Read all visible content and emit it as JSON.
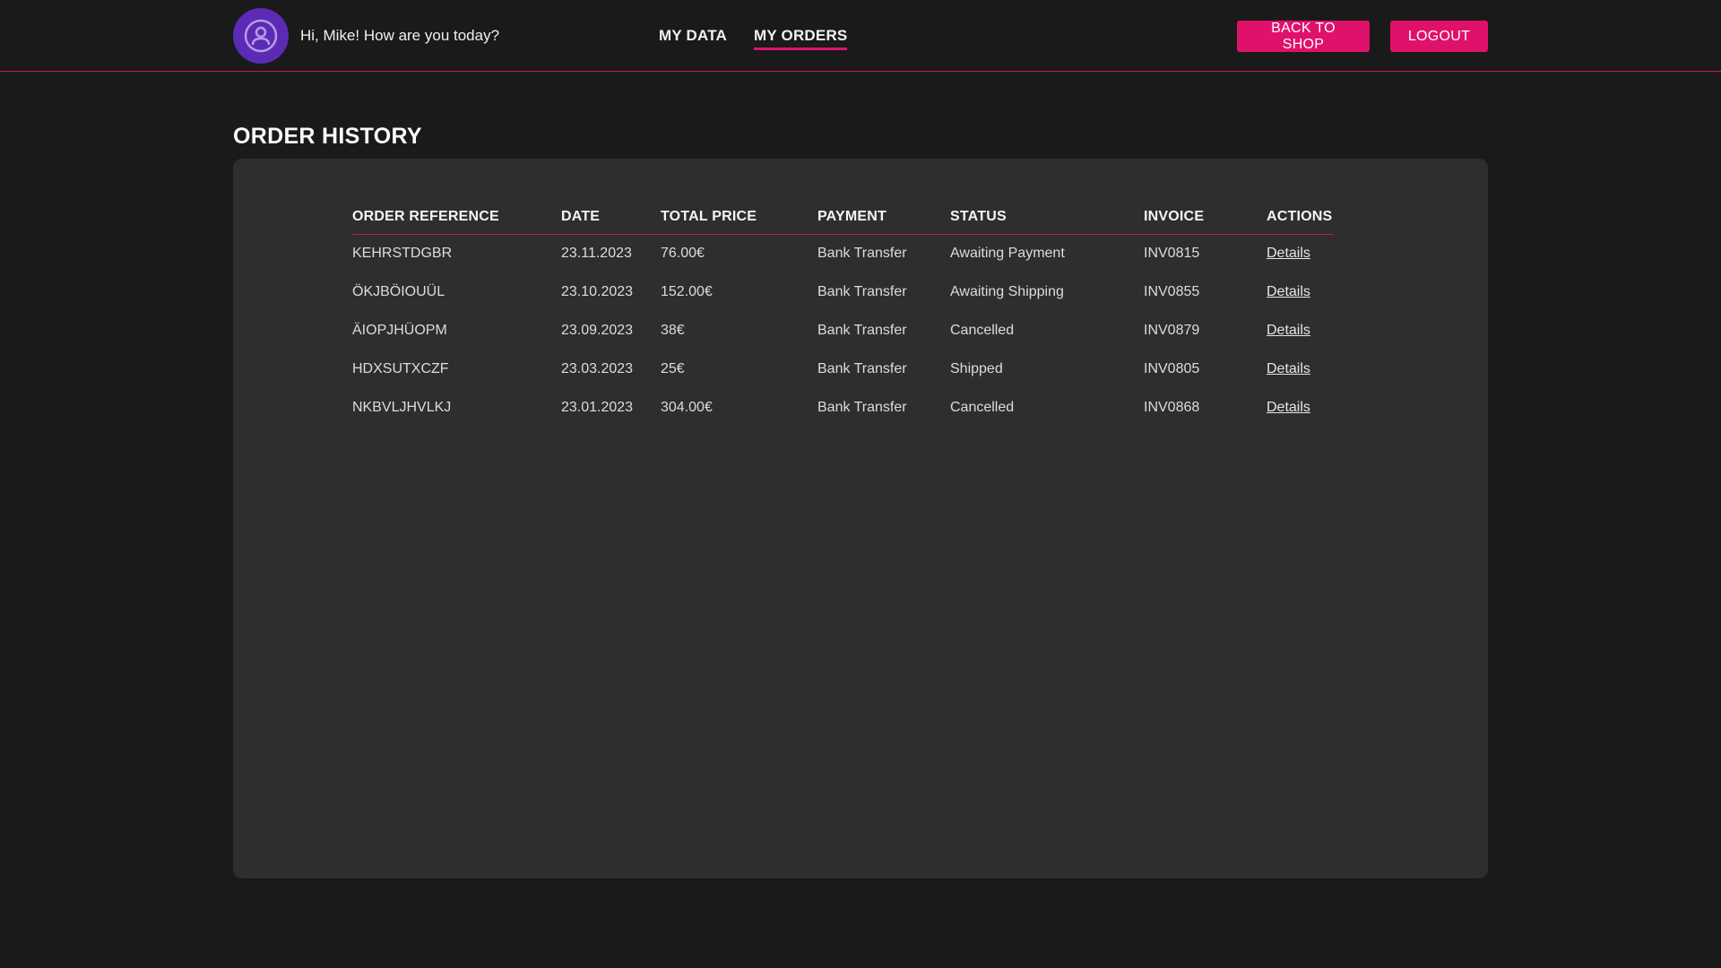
{
  "header": {
    "greeting": "Hi, Mike! How are you today?",
    "nav": [
      {
        "label": "MY DATA"
      },
      {
        "label": "MY ORDERS",
        "active": true
      }
    ],
    "back_to_shop_label": "BACK TO SHOP",
    "logout_label": "LOGOUT",
    "avatar_icon": "user-icon"
  },
  "page": {
    "title": "ORDER HISTORY"
  },
  "orders": {
    "columns": [
      "ORDER REFERENCE",
      "DATE",
      "TOTAL PRICE",
      "PAYMENT",
      "STATUS",
      "INVOICE",
      "ACTIONS"
    ],
    "rows": [
      {
        "reference": "KEHRSTDGBR",
        "date": "23.11.2023",
        "total": "76.00€",
        "payment": "Bank Transfer",
        "status": "Awaiting Payment",
        "invoice": "INV0815",
        "action": "Details"
      },
      {
        "reference": "ÖKJBÖIOUÜL",
        "date": "23.10.2023",
        "total": "152.00€",
        "payment": "Bank Transfer",
        "status": "Awaiting Shipping",
        "invoice": "INV0855",
        "action": "Details"
      },
      {
        "reference": "ÄIOPJHÜOPM",
        "date": "23.09.2023",
        "total": "38€",
        "payment": "Bank Transfer",
        "status": "Cancelled",
        "invoice": "INV0879",
        "action": "Details"
      },
      {
        "reference": "HDXSUTXCZF",
        "date": "23.03.2023",
        "total": "25€",
        "payment": "Bank Transfer",
        "status": "Shipped",
        "invoice": "INV0805",
        "action": "Details"
      },
      {
        "reference": "NKBVLJHVLKJ",
        "date": "23.01.2023",
        "total": "304.00€",
        "payment": "Bank Transfer",
        "status": "Cancelled",
        "invoice": "INV0868",
        "action": "Details"
      }
    ]
  },
  "colors": {
    "accent": "#e0116b",
    "avatar": "#5b2bb5",
    "background": "#1a1a1a",
    "panel": "#2e2e2e"
  }
}
